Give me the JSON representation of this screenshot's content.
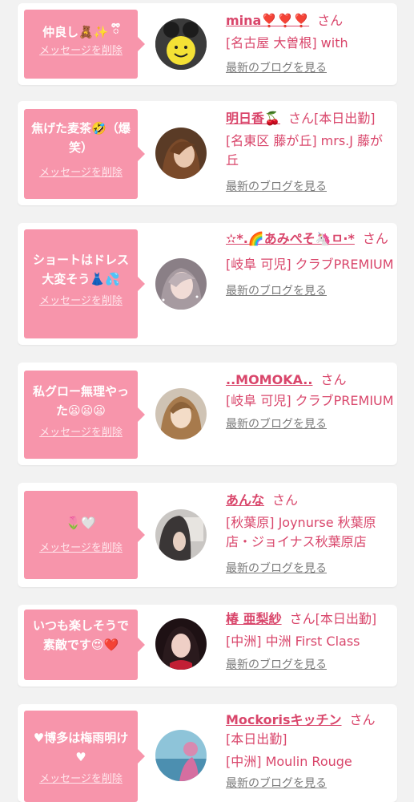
{
  "delete_label": "メッセージを削除",
  "blog_label": "最新のブログを見る",
  "colors": {
    "accent": "#f795ab",
    "name": "#d9466b"
  },
  "entries": [
    {
      "message": "仲良し🧸✨ ྀི",
      "name": "mina❣️❣️❣️",
      "san": "さん",
      "location": "[名古屋 大曽根] with",
      "status": ""
    },
    {
      "message": "焦げた麦茶🤣（爆笑）",
      "name": "明日香🍒",
      "san": "さん",
      "location": "[名東区 藤が丘] mrs.J 藤が丘",
      "status": "[本日出勤]"
    },
    {
      "message": "ショートはドレス大変そう👗💦",
      "name": "✫*.🌈あみぺそ🦄ㅁ·*",
      "san": "さん",
      "location": "[岐阜 可児] クラブPREMIUM",
      "status": ""
    },
    {
      "message": "私グロー無理やった😦😦😦",
      "name": "..MOMOKA..",
      "san": "さん",
      "location": "[岐阜 可児] クラブPREMIUM",
      "status": ""
    },
    {
      "message": "🌷🤍",
      "name": "あんな",
      "san": "さん",
      "location": "[秋葉原] Joynurse 秋葉原店・ジョイナス秋葉原店",
      "status": ""
    },
    {
      "message": "いつも楽しそうで素敵です😍❤️",
      "name": "椿 亜梨紗",
      "san": "さん",
      "location": "[中洲] 中洲 First Class",
      "status": "[本日出勤]"
    },
    {
      "message": "♥博多は梅雨明け♥",
      "name": "Mockorisキッチン",
      "san": "さん",
      "location": "[中洲] Moulin Rouge",
      "status": "[本日出勤]"
    }
  ]
}
